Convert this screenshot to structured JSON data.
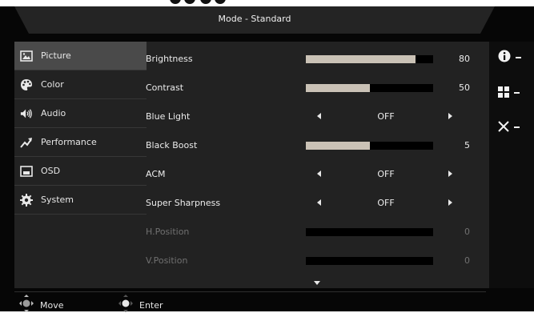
{
  "header": {
    "title": "Mode - Standard"
  },
  "sidebar": {
    "items": [
      {
        "label": "Picture",
        "icon": "picture-icon",
        "active": true
      },
      {
        "label": "Color",
        "icon": "palette-icon",
        "active": false
      },
      {
        "label": "Audio",
        "icon": "speaker-icon",
        "active": false
      },
      {
        "label": "Performance",
        "icon": "trend-up-icon",
        "active": false
      },
      {
        "label": "OSD",
        "icon": "osd-window-icon",
        "active": false
      },
      {
        "label": "System",
        "icon": "gear-icon",
        "active": false
      }
    ]
  },
  "settings": [
    {
      "label": "Brightness",
      "type": "slider",
      "value": "80",
      "level": 0.86,
      "enabled": true
    },
    {
      "label": "Contrast",
      "type": "slider",
      "value": "50",
      "level": 0.5,
      "enabled": true
    },
    {
      "label": "Blue Light",
      "type": "select",
      "value": "OFF",
      "enabled": true
    },
    {
      "label": "Black Boost",
      "type": "slider",
      "value": "5",
      "level": 0.5,
      "enabled": true
    },
    {
      "label": "ACM",
      "type": "select",
      "value": "OFF",
      "enabled": true
    },
    {
      "label": "Super Sharpness",
      "type": "select",
      "value": "OFF",
      "enabled": true
    },
    {
      "label": "H.Position",
      "type": "slider",
      "value": "0",
      "level": 0,
      "enabled": false
    },
    {
      "label": "V.Position",
      "type": "slider",
      "value": "0",
      "level": 0,
      "enabled": false
    }
  ],
  "footer": {
    "move_label": "Move",
    "enter_label": "Enter"
  },
  "hotkeys": [
    {
      "icon": "info-icon"
    },
    {
      "icon": "grid-icon"
    },
    {
      "icon": "close-icon"
    }
  ],
  "colors": {
    "slider_fill": "#cac2b6",
    "active_item": "#4a4a4a",
    "panel": "#222222",
    "background": "#060606"
  }
}
